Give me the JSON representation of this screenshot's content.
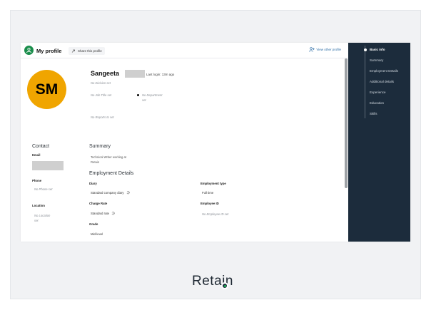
{
  "header": {
    "title": "My profile",
    "share_label": "Share this profile",
    "view_other_label": "View other profile"
  },
  "profile": {
    "initials": "SM",
    "first_name": "Sangeeta",
    "last_login": "Last login: 13m ago",
    "division": "No Division set",
    "job_title": "No Job Title set",
    "department": "No Department set",
    "reports_to": "No Reports to set"
  },
  "contact": {
    "heading": "Contact",
    "email_label": "Email",
    "phone_label": "Phone",
    "phone_value": "No Phone set",
    "location_label": "Location",
    "location_value": "No Location set"
  },
  "summary": {
    "heading": "Summary",
    "text": "Technical Writer working at Retain"
  },
  "employment": {
    "heading": "Employment Details",
    "diary_label": "Diary",
    "diary_value": "Standard company diary",
    "type_label": "Employment type",
    "type_value": "Full time",
    "charge_label": "Charge Rate",
    "charge_value": "Standard rate",
    "employee_id_label": "Employee ID",
    "employee_id_value": "No Employee ID set",
    "grade_label": "Grade",
    "grade_value": "Mid-level"
  },
  "sidebar": {
    "items": [
      {
        "label": "Basic info",
        "active": true
      },
      {
        "label": "Summary"
      },
      {
        "label": "Employment Details"
      },
      {
        "label": "Additional details"
      },
      {
        "label": "Experience"
      },
      {
        "label": "Education"
      },
      {
        "label": "Skills"
      }
    ]
  },
  "brand": {
    "wordmark": "Retain"
  },
  "colors": {
    "accent_green": "#1a8d4b",
    "avatar": "#f0a500",
    "sidebar_bg": "#1c2c3c",
    "link": "#2f6fa7"
  }
}
